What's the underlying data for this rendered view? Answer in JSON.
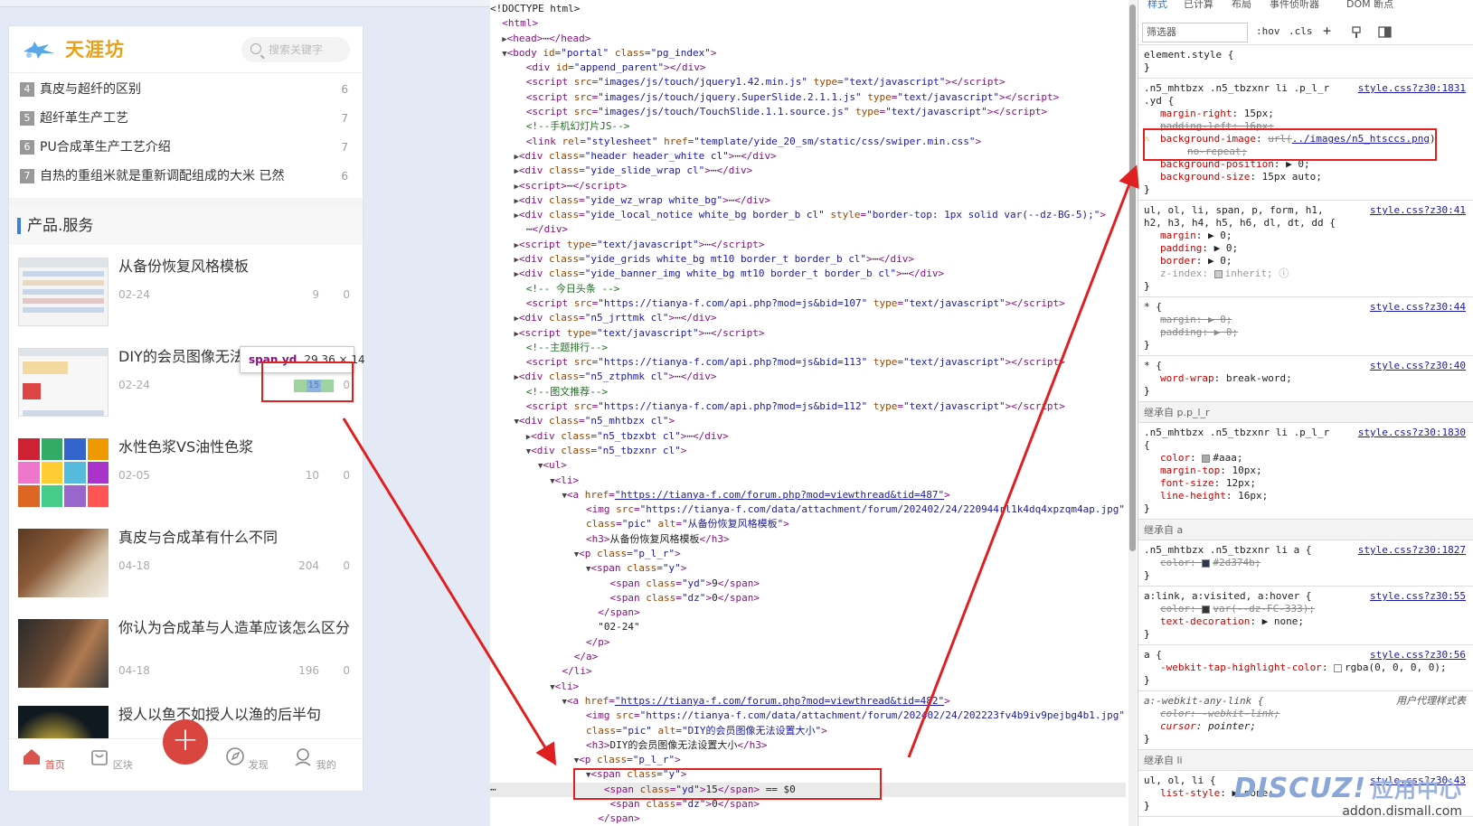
{
  "mobile": {
    "logo_text": "天涯坊",
    "search_placeholder": "搜索关键字",
    "rank_list": [
      {
        "num": "4",
        "title": "真皮与超纤的区别",
        "count": "6"
      },
      {
        "num": "5",
        "title": "超纤革生产工艺",
        "count": "7"
      },
      {
        "num": "6",
        "title": "PU合成革生产工艺介绍",
        "count": "7"
      },
      {
        "num": "7",
        "title": "自热的重组米就是重新调配组成的大米 已然",
        "count": "6"
      }
    ],
    "section_title": "产品.服务",
    "articles": [
      {
        "title": "从备份恢复风格模板",
        "date": "02-24",
        "views": "9",
        "replies": "0"
      },
      {
        "title": "DIY的会员图像无法",
        "date": "02-24",
        "views": "15",
        "replies": "0"
      },
      {
        "title": "水性色浆VS油性色浆",
        "date": "02-05",
        "views": "10",
        "replies": "0"
      },
      {
        "title": "真皮与合成革有什么不同",
        "date": "04-18",
        "views": "204",
        "replies": "0"
      },
      {
        "title": "你认为合成革与人造革应该怎么区分",
        "date": "04-18",
        "views": "196",
        "replies": "0"
      },
      {
        "title": "授人以鱼不如授人以渔的后半句",
        "date": "",
        "views": "",
        "replies": ""
      }
    ],
    "tabbar": {
      "home": "首页",
      "blocks": "区块",
      "discover": "发现",
      "mine": "我的",
      "plus": "+"
    },
    "tooltip": {
      "name": "span.yd",
      "dims": "29.36 × 14"
    },
    "highlight_value": "15"
  },
  "styles": {
    "tabs": [
      "样式",
      "已计算",
      "布局",
      "事件侦听器",
      "DOM 断点"
    ],
    "filter": "筛选器",
    "toolbar": [
      ":hov",
      ".cls",
      "+"
    ],
    "inherited": [
      "继承自 p.p_l_r",
      "继承自 a",
      "继承自 li"
    ]
  },
  "watermark": {
    "brand": "DISCUZ!",
    "suffix": "应用中心",
    "url": "addon.dismall.com"
  },
  "colors": {
    "accent_red": "#e02020",
    "logo_orange": "#e8a018",
    "highlight": "#d9463f"
  }
}
